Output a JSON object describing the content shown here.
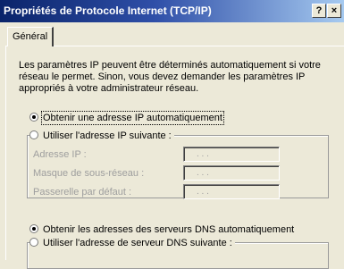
{
  "window": {
    "title": "Propriétés de Protocole Internet (TCP/IP)",
    "help_label": "?",
    "close_label": "×"
  },
  "tabs": [
    {
      "label": "Général",
      "selected": true
    }
  ],
  "description": "Les paramètres IP peuvent être déterminés automatiquement si votre réseau le permet. Sinon, vous devez demander les paramètres IP appropriés à votre administrateur réseau.",
  "ip_options": {
    "auto_label": "Obtenir une adresse IP automatiquement",
    "auto_selected": true,
    "manual_label": "Utiliser l'adresse IP suivante :",
    "manual_selected": false
  },
  "ip_fields": [
    {
      "label": "Adresse IP :",
      "value": ".  .  ."
    },
    {
      "label": "Masque de sous-réseau :",
      "value": ".  .  ."
    },
    {
      "label": "Passerelle par défaut :",
      "value": ".  .  ."
    }
  ],
  "dns_options": {
    "auto_label": "Obtenir les adresses des serveurs DNS automatiquement",
    "auto_selected": true,
    "manual_label": "Utiliser l'adresse de serveur DNS suivante :",
    "manual_selected": false
  },
  "colors": {
    "titlebar_start": "#0a246a",
    "titlebar_end": "#a6caf0",
    "dialog_bg": "#ece9d8",
    "disabled_text": "#9e9e9e"
  }
}
